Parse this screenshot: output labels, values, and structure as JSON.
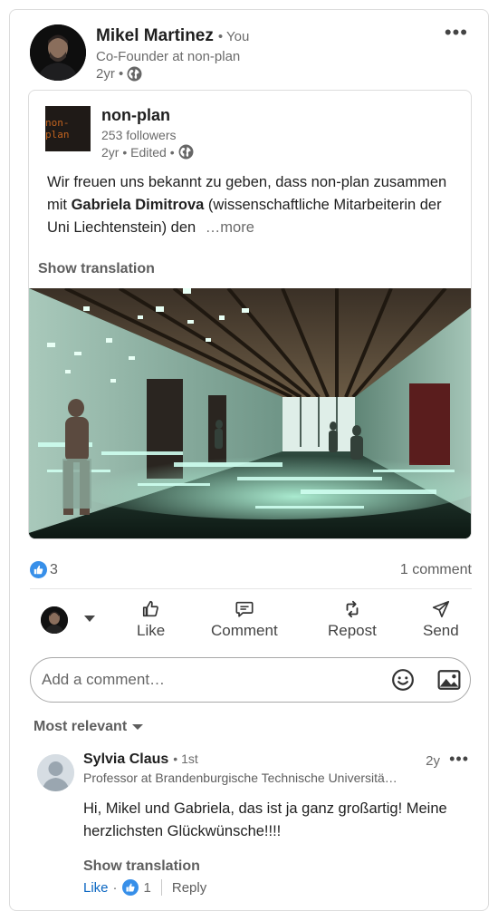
{
  "author": {
    "name": "Mikel Martinez",
    "you": "• You",
    "headline": "Co-Founder at non-plan",
    "time": "2yr •"
  },
  "shared": {
    "org_name": "non-plan",
    "org_logo_text": "non-plan",
    "followers": "253 followers",
    "meta": "2yr • Edited •",
    "text_part1": "Wir freuen uns bekannt zu geben, dass non-plan zusammen mit ",
    "text_bold": "Gabriela Dimitrova",
    "text_part2": " (wissenschaftliche Mitarbeiterin der Uni Liechtenstein) den",
    "more": "…more",
    "show_translation": "Show translation"
  },
  "social": {
    "reactions_count": "3",
    "comments_count": "1 comment"
  },
  "actions": {
    "like": "Like",
    "comment": "Comment",
    "repost": "Repost",
    "send": "Send"
  },
  "comment_box": {
    "placeholder": "Add a comment…"
  },
  "sort": {
    "label": "Most relevant"
  },
  "comment": {
    "name": "Sylvia Claus",
    "degree": "• 1st",
    "title": "Professor at Brandenburgische Technische Universitä…",
    "time": "2y",
    "text": "Hi, Mikel und Gabriela, das ist ja ganz großartig! Meine herzlichsten Glückwünsche!!!!",
    "show_translation": "Show translation",
    "like": "Like",
    "dot": "·",
    "reaction_count": "1",
    "reply": "Reply"
  },
  "icons": {
    "more": "more-dots-icon",
    "globe": "globe-icon",
    "like": "thumbs-up-icon",
    "comment": "comment-bubble-icon",
    "repost": "repost-icon",
    "send": "send-icon",
    "emoji": "smiley-icon",
    "image": "image-icon"
  },
  "colors": {
    "accent": "#0a66c2",
    "text": "#1f1f1f",
    "muted": "#6b6b6b"
  }
}
